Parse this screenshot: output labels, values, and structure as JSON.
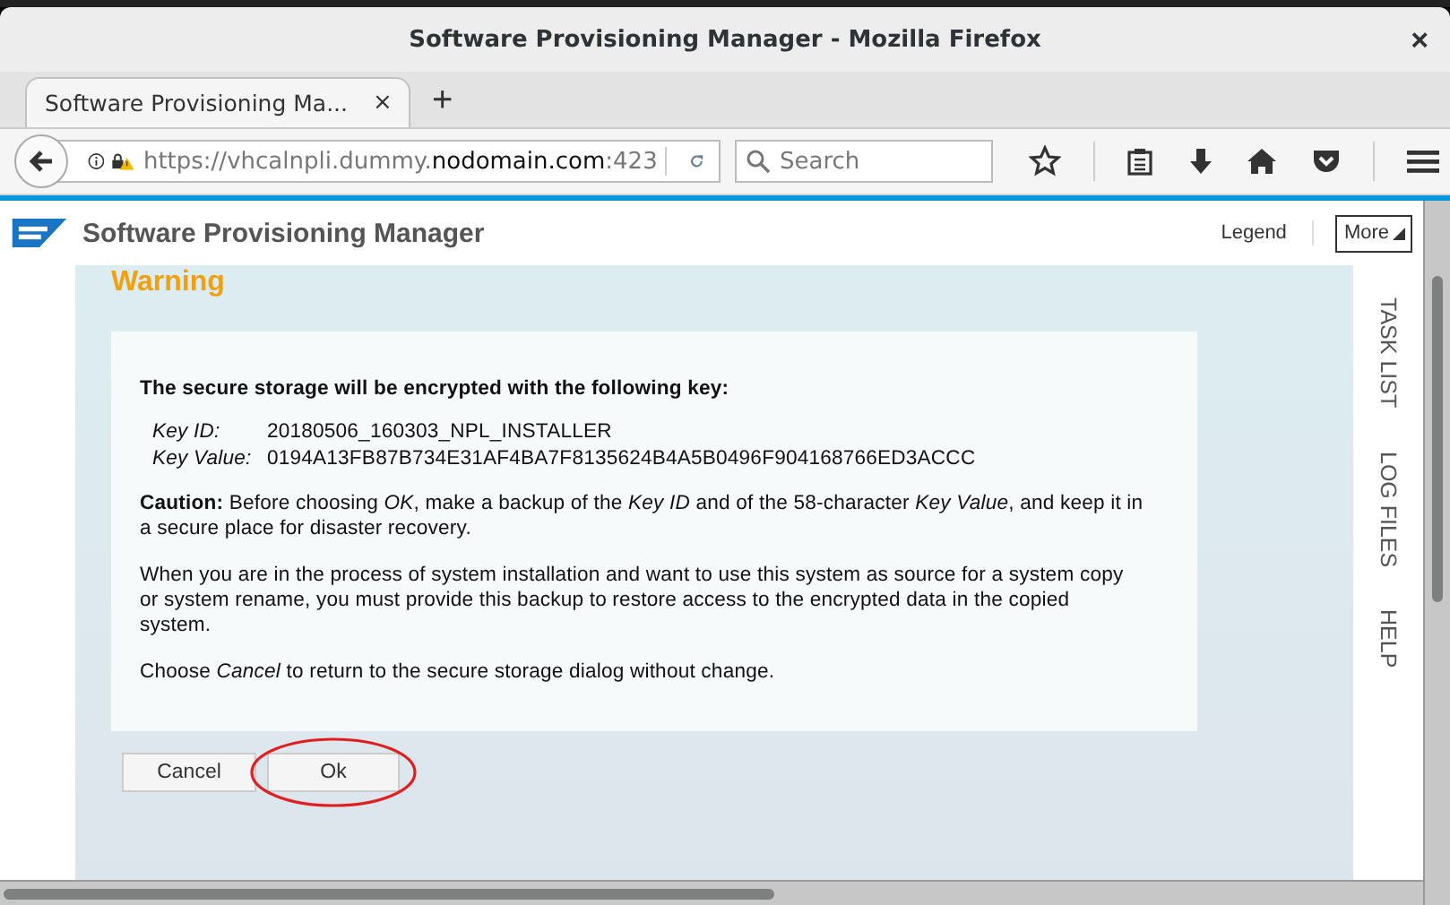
{
  "window": {
    "title": "Software Provisioning Manager - Mozilla Firefox",
    "close": "×"
  },
  "tabs": [
    {
      "label": "Software Provisioning Ma...",
      "close": "×",
      "selected": true
    }
  ],
  "new_tab": "+",
  "address_bar": {
    "url_prefix": "https://vhcalnpli.dummy.",
    "url_domain": "nodomain.com",
    "url_suffix": ":423"
  },
  "search": {
    "placeholder": "Search"
  },
  "app_header": {
    "title": "Software Provisioning Manager",
    "legend": "Legend",
    "more": "More"
  },
  "dialog": {
    "title": "Warning",
    "heading": "The secure storage will be encrypted with the following key:",
    "fields": [
      {
        "label": "Key ID:",
        "value": "20180506_160303_NPL_INSTALLER"
      },
      {
        "label": "Key Value:",
        "value": "0194A13FB87B734E31AF4BA7F8135624B4A5B0496F904168766ED3ACCC"
      }
    ],
    "paragraphs": [
      "**Caution:** Before choosing *OK*, make a backup of the *Key ID* and of the 58-character *Key Value*, and keep it in a secure place for disaster recovery.",
      "When you are in the process of system installation and want to use this system as source for a system copy or system rename, you must provide this backup to restore access to the encrypted data in the copied system.",
      "Choose *Cancel* to return to the secure storage dialog without change."
    ],
    "buttons": [
      {
        "label": "Cancel",
        "highlighted": false
      },
      {
        "label": "Ok",
        "highlighted": true
      }
    ]
  },
  "side_tabs": [
    "TASK LIST",
    "LOG FILES",
    "HELP"
  ]
}
